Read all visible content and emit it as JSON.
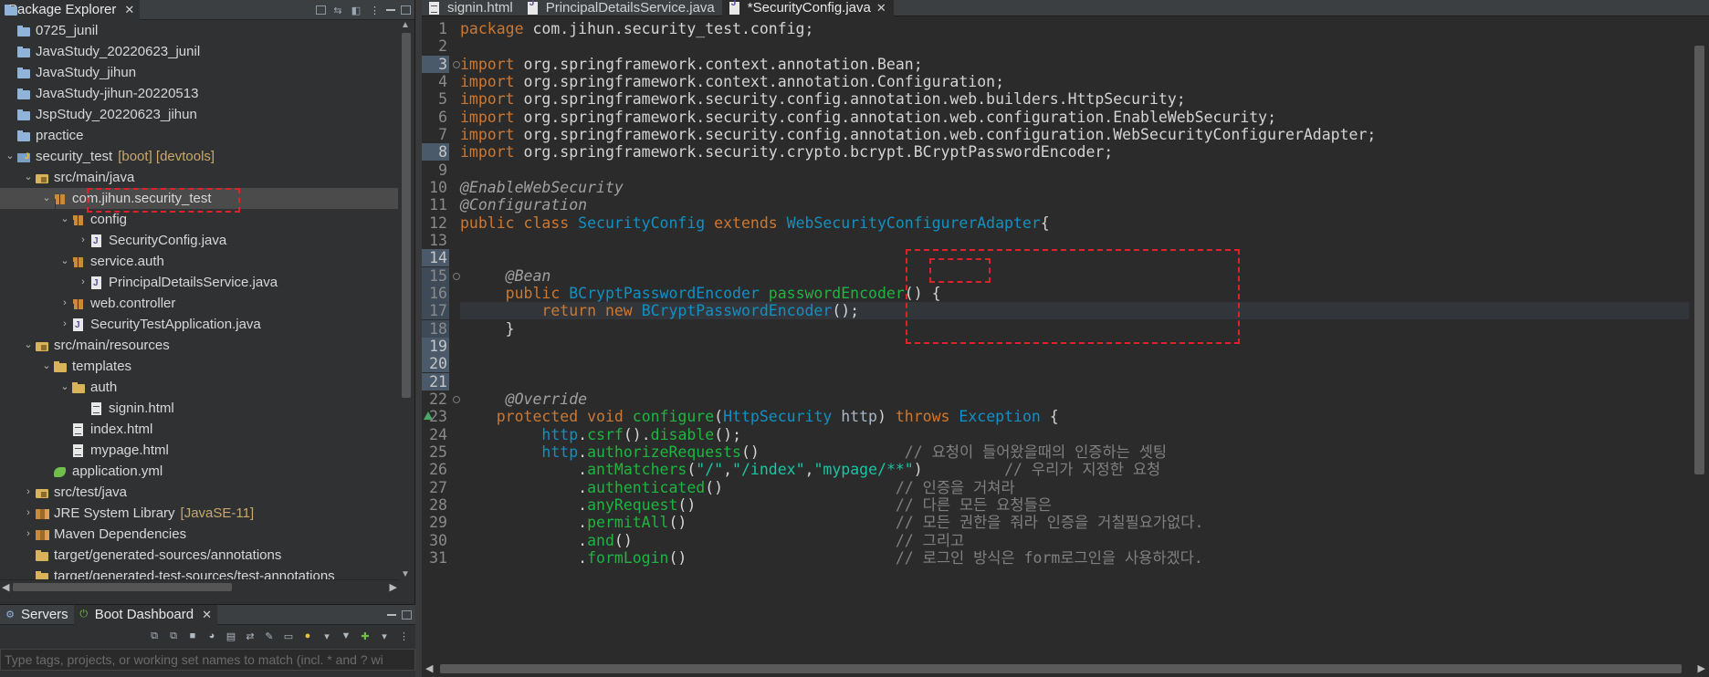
{
  "explorer": {
    "tab_label": "Package Explorer",
    "tree": [
      {
        "label": "0725_junil",
        "kind": "proj",
        "depth": 0,
        "twisty": ""
      },
      {
        "label": "JavaStudy_20220623_junil",
        "kind": "proj",
        "depth": 0,
        "twisty": ""
      },
      {
        "label": "JavaStudy_jihun",
        "kind": "proj",
        "depth": 0,
        "twisty": ""
      },
      {
        "label": "JavaStudy-jihun-20220513",
        "kind": "proj",
        "depth": 0,
        "twisty": ""
      },
      {
        "label": "JspStudy_20220623_jihun",
        "kind": "proj",
        "depth": 0,
        "twisty": ""
      },
      {
        "label": "practice",
        "kind": "proj",
        "depth": 0,
        "twisty": ""
      },
      {
        "label": "security_test",
        "kind": "boot",
        "depth": 0,
        "twisty": "v",
        "suffix": "[boot] [devtools]"
      },
      {
        "label": "src/main/java",
        "kind": "src",
        "depth": 1,
        "twisty": "v"
      },
      {
        "label": "com.jihun.security_test",
        "kind": "pkg",
        "depth": 2,
        "twisty": "v",
        "selected": true
      },
      {
        "label": "config",
        "kind": "pkg",
        "depth": 3,
        "twisty": "v"
      },
      {
        "label": "SecurityConfig.java",
        "kind": "java",
        "depth": 4,
        "twisty": ">"
      },
      {
        "label": "service.auth",
        "kind": "pkg",
        "depth": 3,
        "twisty": "v"
      },
      {
        "label": "PrincipalDetailsService.java",
        "kind": "java",
        "depth": 4,
        "twisty": ">"
      },
      {
        "label": "web.controller",
        "kind": "pkg",
        "depth": 3,
        "twisty": ">"
      },
      {
        "label": "SecurityTestApplication.java",
        "kind": "java",
        "depth": 3,
        "twisty": ">"
      },
      {
        "label": "src/main/resources",
        "kind": "src",
        "depth": 1,
        "twisty": "v"
      },
      {
        "label": "templates",
        "kind": "folder",
        "depth": 2,
        "twisty": "v"
      },
      {
        "label": "auth",
        "kind": "folder",
        "depth": 3,
        "twisty": "v"
      },
      {
        "label": "signin.html",
        "kind": "html",
        "depth": 4,
        "twisty": ""
      },
      {
        "label": "index.html",
        "kind": "html",
        "depth": 3,
        "twisty": ""
      },
      {
        "label": "mypage.html",
        "kind": "html",
        "depth": 3,
        "twisty": ""
      },
      {
        "label": "application.yml",
        "kind": "yml",
        "depth": 2,
        "twisty": ""
      },
      {
        "label": "src/test/java",
        "kind": "src",
        "depth": 1,
        "twisty": ">"
      },
      {
        "label": "JRE System Library",
        "kind": "lib",
        "depth": 1,
        "twisty": ">",
        "suffix": "[JavaSE-11]"
      },
      {
        "label": "Maven Dependencies",
        "kind": "lib",
        "depth": 1,
        "twisty": ">"
      },
      {
        "label": "target/generated-sources/annotations",
        "kind": "folder",
        "depth": 1,
        "twisty": ""
      },
      {
        "label": "target/generated-test-sources/test-annotations",
        "kind": "folder",
        "depth": 1,
        "twisty": ""
      }
    ]
  },
  "bottom": {
    "servers_tab": "Servers",
    "boot_tab": "Boot Dashboard",
    "filter_placeholder": "Type tags, projects, or working set names to match (incl. * and ? wi"
  },
  "editor": {
    "tabs": [
      {
        "label": "signin.html",
        "kind": "html",
        "active": false,
        "closable": false
      },
      {
        "label": "PrincipalDetailsService.java",
        "kind": "java",
        "active": false,
        "closable": false
      },
      {
        "label": "*SecurityConfig.java",
        "kind": "java",
        "active": true,
        "closable": true
      }
    ],
    "lines": [
      {
        "n": "1",
        "t": [
          [
            "kw",
            "package"
          ],
          [
            "pl",
            " com.jihun.security_test.config;"
          ]
        ]
      },
      {
        "n": "2",
        "t": []
      },
      {
        "n": "3",
        "t": [
          [
            "kw",
            "import"
          ],
          [
            "pl",
            " org.springframework.context.annotation.Bean;"
          ]
        ],
        "hl": true,
        "fold": true
      },
      {
        "n": "4",
        "t": [
          [
            "kw",
            "import"
          ],
          [
            "pl",
            " org.springframework.context.annotation.Configuration;"
          ]
        ]
      },
      {
        "n": "5",
        "t": [
          [
            "kw",
            "import"
          ],
          [
            "pl",
            " org.springframework.security.config.annotation.web.builders.HttpSecurity;"
          ]
        ]
      },
      {
        "n": "6",
        "t": [
          [
            "kw",
            "import"
          ],
          [
            "pl",
            " org.springframework.security.config.annotation.web.configuration.EnableWebSecurity;"
          ]
        ]
      },
      {
        "n": "7",
        "t": [
          [
            "kw",
            "import"
          ],
          [
            "pl",
            " org.springframework.security.config.annotation.web.configuration.WebSecurityConfigurerAdapter;"
          ]
        ]
      },
      {
        "n": "8",
        "t": [
          [
            "kw",
            "import"
          ],
          [
            "pl",
            " org.springframework.security.crypto.bcrypt.BCryptPasswordEncoder;"
          ]
        ],
        "hl": true
      },
      {
        "n": "9",
        "t": []
      },
      {
        "n": "10",
        "t": [
          [
            "an",
            "@EnableWebSecurity"
          ]
        ]
      },
      {
        "n": "11",
        "t": [
          [
            "an",
            "@Configuration"
          ]
        ]
      },
      {
        "n": "12",
        "t": [
          [
            "kw",
            "public class "
          ],
          [
            "ty",
            "SecurityConfig "
          ],
          [
            "kw",
            "extends "
          ],
          [
            "ty",
            "WebSecurityConfigurerAdapter"
          ],
          [
            "pl",
            "{"
          ]
        ]
      },
      {
        "n": "13",
        "t": []
      },
      {
        "n": "14",
        "t": [],
        "hl": true
      },
      {
        "n": "15",
        "t": [
          [
            "pl",
            "     "
          ],
          [
            "an",
            "@Bean"
          ]
        ],
        "occ": true,
        "fold": true
      },
      {
        "n": "16",
        "t": [
          [
            "pl",
            "     "
          ],
          [
            "kw",
            "public "
          ],
          [
            "ty",
            "BCryptPasswordEncoder "
          ],
          [
            "fn",
            "passwordEncoder"
          ],
          [
            "pl",
            "() {"
          ]
        ],
        "occ": true
      },
      {
        "n": "17",
        "t": [
          [
            "pl",
            "         "
          ],
          [
            "kw",
            "return new "
          ],
          [
            "ty",
            "BCryptPasswordEncoder"
          ],
          [
            "pl",
            "();"
          ]
        ],
        "occ": true,
        "cur": true
      },
      {
        "n": "18",
        "t": [
          [
            "pl",
            "     }"
          ]
        ],
        "occ": true
      },
      {
        "n": "19",
        "t": [],
        "hl": true
      },
      {
        "n": "20",
        "t": [],
        "hl": true
      },
      {
        "n": "21",
        "t": [],
        "hl": true
      },
      {
        "n": "22",
        "t": [
          [
            "pl",
            "     "
          ],
          [
            "an",
            "@Override"
          ]
        ],
        "fold": true
      },
      {
        "n": "23",
        "t": [
          [
            "pl",
            "    "
          ],
          [
            "kw",
            "protected void "
          ],
          [
            "fn",
            "configure"
          ],
          [
            "pl",
            "("
          ],
          [
            "ty",
            "HttpSecurity "
          ],
          [
            "var",
            "http"
          ],
          [
            "pl",
            ") "
          ],
          [
            "kw",
            "throws "
          ],
          [
            "ty",
            "Exception "
          ],
          [
            "pl",
            "{"
          ]
        ],
        "warn": true
      },
      {
        "n": "24",
        "t": [
          [
            "pl",
            "         "
          ],
          [
            "ty",
            "http"
          ],
          [
            "pl",
            "."
          ],
          [
            "fn",
            "csrf"
          ],
          [
            "pl",
            "()."
          ],
          [
            "fn",
            "disable"
          ],
          [
            "pl",
            "();"
          ]
        ]
      },
      {
        "n": "25",
        "t": [
          [
            "pl",
            "         "
          ],
          [
            "ty",
            "http"
          ],
          [
            "pl",
            "."
          ],
          [
            "fn",
            "authorizeRequests"
          ],
          [
            "pl",
            "()                "
          ],
          [
            "cm",
            "// 요청이 들어왔을때의 인증하는 셋팅"
          ]
        ]
      },
      {
        "n": "26",
        "t": [
          [
            "pl",
            "             ."
          ],
          [
            "fn",
            "antMatchers"
          ],
          [
            "pl",
            "("
          ],
          [
            "st",
            "\"/\""
          ],
          [
            "pl",
            ","
          ],
          [
            "st",
            "\"/index\""
          ],
          [
            "pl",
            ","
          ],
          [
            "st",
            "\"mypage/**\""
          ],
          [
            "pl",
            ")         "
          ],
          [
            "cm",
            "// 우리가 지정한 요청"
          ]
        ]
      },
      {
        "n": "27",
        "t": [
          [
            "pl",
            "             ."
          ],
          [
            "fn",
            "authenticated"
          ],
          [
            "pl",
            "()                   "
          ],
          [
            "cm",
            "// 인증을 거쳐라"
          ]
        ]
      },
      {
        "n": "28",
        "t": [
          [
            "pl",
            "             ."
          ],
          [
            "fn",
            "anyRequest"
          ],
          [
            "pl",
            "()                      "
          ],
          [
            "cm",
            "// 다른 모든 요청들은"
          ]
        ]
      },
      {
        "n": "29",
        "t": [
          [
            "pl",
            "             ."
          ],
          [
            "fn",
            "permitAll"
          ],
          [
            "pl",
            "()                       "
          ],
          [
            "cm",
            "// 모든 권한을 줘라 인증을 거칠필요가없다."
          ]
        ]
      },
      {
        "n": "30",
        "t": [
          [
            "pl",
            "             ."
          ],
          [
            "fn",
            "and"
          ],
          [
            "pl",
            "()                             "
          ],
          [
            "cm",
            "// 그리고"
          ]
        ]
      },
      {
        "n": "31",
        "t": [
          [
            "pl",
            "             ."
          ],
          [
            "fn",
            "formLogin"
          ],
          [
            "pl",
            "()                       "
          ],
          [
            "cm",
            "// 로그인 방식은 form로그인을 사용하겠다."
          ]
        ]
      }
    ]
  }
}
